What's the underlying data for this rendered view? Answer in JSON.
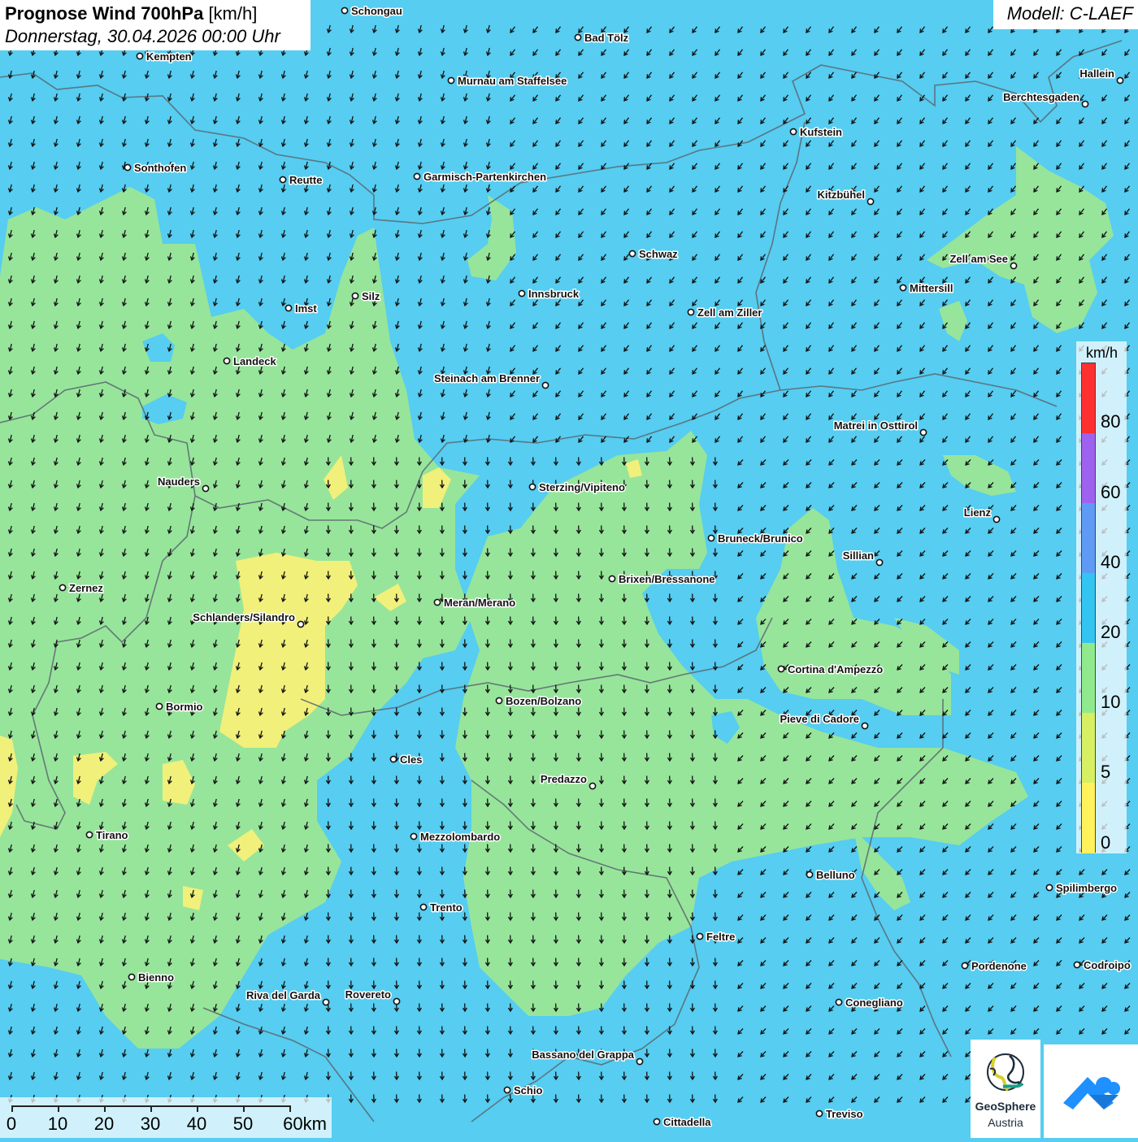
{
  "header": {
    "title_bold": "Prognose Wind 700hPa",
    "title_unit": "[km/h]",
    "datetime": "Donnerstag, 30.04.2026 00:00 Uhr"
  },
  "model": {
    "label": "Modell: C-LAEF"
  },
  "legend": {
    "unit": "km/h",
    "ticks": [
      "80",
      "60",
      "40",
      "20",
      "10",
      "5",
      "0"
    ],
    "colors": [
      "#ff3030",
      "#9e62ee",
      "#5f9bf5",
      "#34c4f2",
      "#90e98c",
      "#d7ef62",
      "#fff25c"
    ]
  },
  "scalebar": {
    "ticks": [
      "0",
      "10",
      "20",
      "30",
      "40",
      "50",
      "60km"
    ]
  },
  "logos": {
    "geosphere_name": "GeoSphere",
    "geosphere_sub": "Austria"
  },
  "colors": {
    "calm_blue": "#56cdf1",
    "green": "#97e59b",
    "yellow": "#f1f07a"
  },
  "cities": [
    {
      "name": "Schongau"
    },
    {
      "name": "Bad Tölz"
    },
    {
      "name": "Kempten"
    },
    {
      "name": "Murnau am Staffelsee"
    },
    {
      "name": "Hallein"
    },
    {
      "name": "Berchtesgaden"
    },
    {
      "name": "Kufstein"
    },
    {
      "name": "Sonthofen"
    },
    {
      "name": "Reutte"
    },
    {
      "name": "Garmisch-Partenkirchen"
    },
    {
      "name": "Kitzbühel"
    },
    {
      "name": "Schwaz"
    },
    {
      "name": "Zell am See"
    },
    {
      "name": "Mittersill"
    },
    {
      "name": "Imst"
    },
    {
      "name": "Silz"
    },
    {
      "name": "Innsbruck"
    },
    {
      "name": "Zell am Ziller"
    },
    {
      "name": "Landeck"
    },
    {
      "name": "Steinach am Brenner"
    },
    {
      "name": "Matrei in Osttirol"
    },
    {
      "name": "Nauders"
    },
    {
      "name": "Sterzing/Vipiteno"
    },
    {
      "name": "Lienz"
    },
    {
      "name": "Bruneck/Brunico"
    },
    {
      "name": "Sillian"
    },
    {
      "name": "Zernez"
    },
    {
      "name": "Brixen/Bressanone"
    },
    {
      "name": "Meran/Merano"
    },
    {
      "name": "Schlanders/Silandro"
    },
    {
      "name": "Cortina d'Ampezzo"
    },
    {
      "name": "Bozen/Bolzano"
    },
    {
      "name": "Bormio"
    },
    {
      "name": "Pieve di Cadore"
    },
    {
      "name": "Cles"
    },
    {
      "name": "Predazzo"
    },
    {
      "name": "Tirano"
    },
    {
      "name": "Mezzolombardo"
    },
    {
      "name": "Belluno"
    },
    {
      "name": "Spilimbergo"
    },
    {
      "name": "Trento"
    },
    {
      "name": "Feltre"
    },
    {
      "name": "Pordenone"
    },
    {
      "name": "Codroipo"
    },
    {
      "name": "Bienno"
    },
    {
      "name": "Riva del Garda"
    },
    {
      "name": "Rovereto"
    },
    {
      "name": "Conegliano"
    },
    {
      "name": "Bassano del Grappa"
    },
    {
      "name": "Schio"
    },
    {
      "name": "Treviso"
    },
    {
      "name": "Cittadella"
    }
  ]
}
